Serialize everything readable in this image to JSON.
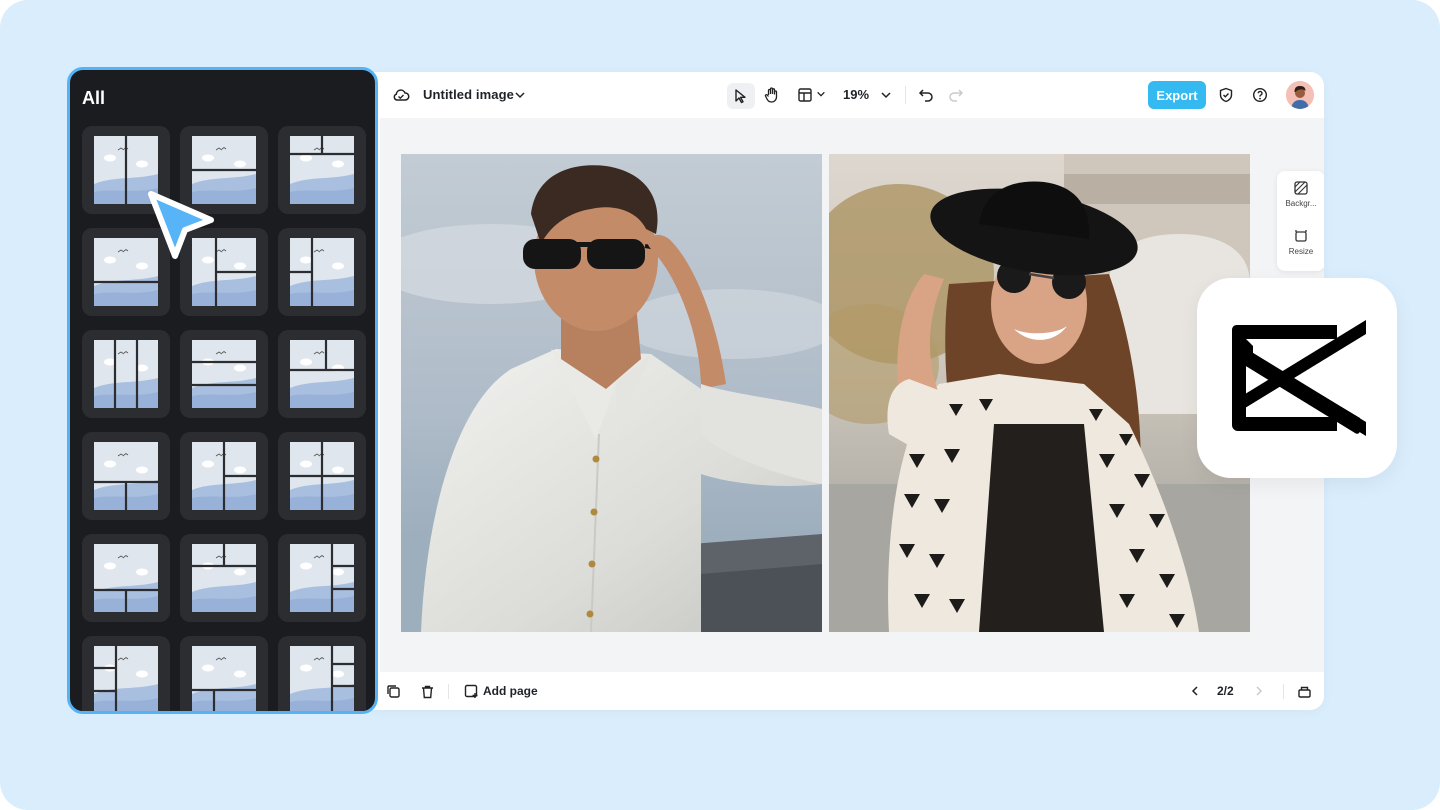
{
  "app": {
    "doc_title": "Untitled image",
    "zoom": "19%",
    "export_label": "Export",
    "accent_color": "#34b9f0",
    "panel_border_color": "#55b3f5"
  },
  "toolbar": {
    "icons": [
      "cloud-icon",
      "chevron-down-icon",
      "select-pointer-icon",
      "hand-icon",
      "layout-icon",
      "undo-icon",
      "redo-icon",
      "shield-icon",
      "help-icon",
      "avatar"
    ]
  },
  "side_tools": {
    "background_label": "Backgr...",
    "resize_label": "Resize"
  },
  "bottom": {
    "add_page_label": "Add page",
    "page_indicator": "2/2"
  },
  "template_panel": {
    "title": "All",
    "templates": [
      {
        "layout": "split-vertical-2"
      },
      {
        "layout": "split-horizontal-2"
      },
      {
        "layout": "top-strip-bottom"
      },
      {
        "layout": "big-top-strip-bottom"
      },
      {
        "layout": "left-right-stack"
      },
      {
        "layout": "left-split-right"
      },
      {
        "layout": "three-columns"
      },
      {
        "layout": "three-rows"
      },
      {
        "layout": "two-by-two-offset"
      },
      {
        "layout": "top-bottom-split"
      },
      {
        "layout": "left-two-right"
      },
      {
        "layout": "grid-four"
      },
      {
        "layout": "big-top-two-bottom"
      },
      {
        "layout": "two-top-big-bottom"
      },
      {
        "layout": "left-three-right"
      },
      {
        "layout": "left-stack-right-big"
      },
      {
        "layout": "top-big-bottom-two"
      },
      {
        "layout": "right-stack-left-big"
      }
    ]
  }
}
